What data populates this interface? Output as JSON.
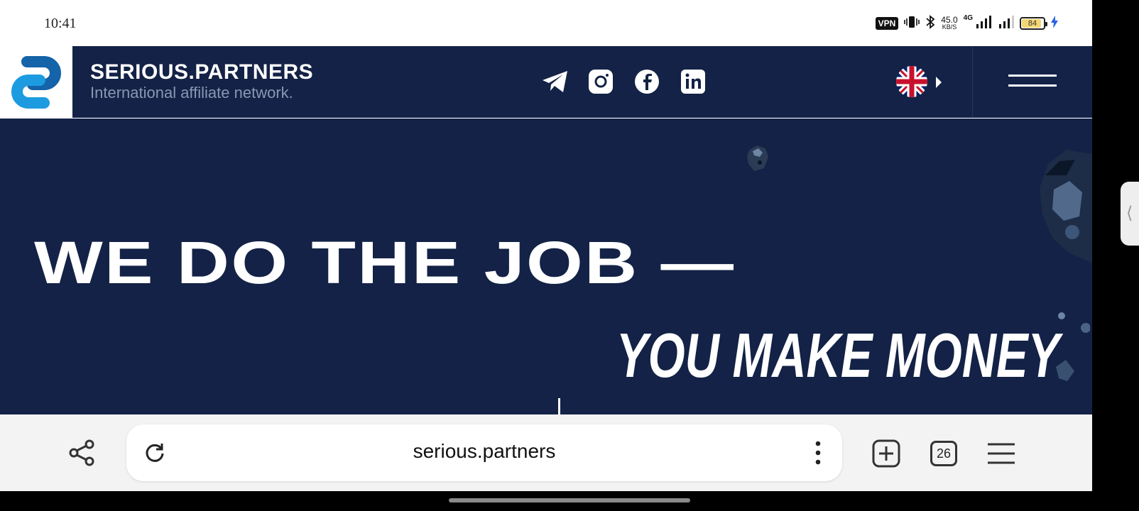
{
  "status_bar": {
    "time": "10:41",
    "vpn": "VPN",
    "net_speed": "45.0",
    "net_speed_unit": "KB/S",
    "net_type": "4G",
    "battery": "84",
    "battery_level": 0.84
  },
  "header": {
    "brand": "SERIOUS.PARTNERS",
    "tagline": "International affiliate network.",
    "socials": [
      "telegram-icon",
      "instagram-icon",
      "facebook-icon",
      "linkedin-icon"
    ],
    "language": "uk-flag-icon"
  },
  "hero": {
    "line1": "WE DO THE JOB —",
    "line2": "YOU MAKE MONEY"
  },
  "browser": {
    "url": "serious.partners",
    "tab_count": "26"
  },
  "colors": {
    "navy": "#132246",
    "logo_blue": "#1d8fd8",
    "white": "#ffffff"
  }
}
